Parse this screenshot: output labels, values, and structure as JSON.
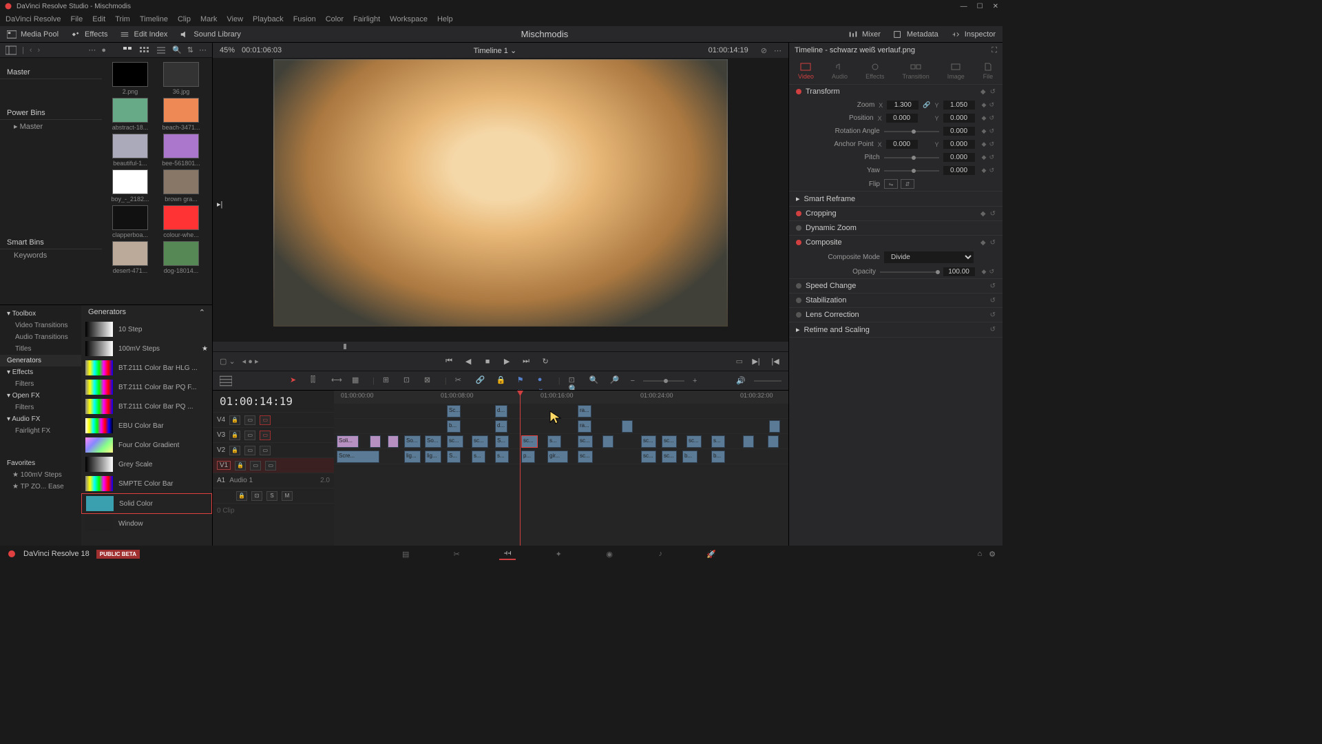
{
  "titlebar": {
    "title": "DaVinci Resolve Studio - Mischmodis"
  },
  "menubar": [
    "DaVinci Resolve",
    "File",
    "Edit",
    "Trim",
    "Timeline",
    "Clip",
    "Mark",
    "View",
    "Playback",
    "Fusion",
    "Color",
    "Fairlight",
    "Workspace",
    "Help"
  ],
  "toolbar": {
    "mediapool": "Media Pool",
    "effects": "Effects",
    "editindex": "Edit Index",
    "soundlib": "Sound Library",
    "mixer": "Mixer",
    "metadata": "Metadata",
    "inspector": "Inspector",
    "project": "Mischmodis"
  },
  "mediapool_bar": {
    "zoom": "45%",
    "tc": "00:01:06:03"
  },
  "bins": {
    "master": "Master",
    "powerbins": "Power Bins",
    "powerbins_master": "Master",
    "smartbins": "Smart Bins",
    "keywords": "Keywords"
  },
  "thumbs": [
    {
      "label": "2.png"
    },
    {
      "label": "36.jpg"
    },
    {
      "label": "abstract-18..."
    },
    {
      "label": "beach-3471..."
    },
    {
      "label": "beautiful-1..."
    },
    {
      "label": "bee-561801..."
    },
    {
      "label": "boy_-_2182..."
    },
    {
      "label": "brown gra..."
    },
    {
      "label": "clapperboa..."
    },
    {
      "label": "colour-whe..."
    },
    {
      "label": "desert-471..."
    },
    {
      "label": "dog-18014..."
    }
  ],
  "fx_tree": [
    {
      "label": "Toolbox",
      "cls": "header"
    },
    {
      "label": "Video Transitions",
      "cls": "child"
    },
    {
      "label": "Audio Transitions",
      "cls": "child"
    },
    {
      "label": "Titles",
      "cls": "child"
    },
    {
      "label": "Generators",
      "cls": "active"
    },
    {
      "label": "Effects",
      "cls": "header"
    },
    {
      "label": "Filters",
      "cls": "child"
    },
    {
      "label": "Open FX",
      "cls": "header"
    },
    {
      "label": "Filters",
      "cls": "child"
    },
    {
      "label": "Audio FX",
      "cls": "header"
    },
    {
      "label": "Fairlight FX",
      "cls": "child"
    }
  ],
  "favorites": {
    "header": "Favorites",
    "items": [
      "100mV Steps",
      "TP ZO... Ease"
    ]
  },
  "generators": {
    "header": "Generators",
    "items": [
      {
        "label": "10 Step",
        "color": "linear-gradient(90deg,#000,#fff)"
      },
      {
        "label": "100mV Steps",
        "color": "linear-gradient(90deg,#000,#fff)",
        "star": true
      },
      {
        "label": "BT.2111 Color Bar HLG ...",
        "color": "linear-gradient(90deg,#888,#ff0,#0ff,#0f0,#f0f,#f00,#00f)"
      },
      {
        "label": "BT.2111 Color Bar PQ F...",
        "color": "linear-gradient(90deg,#888,#ff0,#0ff,#0f0,#f0f,#f00,#00f)"
      },
      {
        "label": "BT.2111 Color Bar PQ ...",
        "color": "linear-gradient(90deg,#888,#ff0,#0ff,#0f0,#f0f,#f00,#00f)"
      },
      {
        "label": "EBU Color Bar",
        "color": "linear-gradient(90deg,#fff,#ff0,#0ff,#0f0,#f0f,#f00,#00f,#000)"
      },
      {
        "label": "Four Color Gradient",
        "color": "linear-gradient(135deg,#f8f,#88f,#8f8,#ff8)"
      },
      {
        "label": "Grey Scale",
        "color": "linear-gradient(90deg,#000,#fff)"
      },
      {
        "label": "SMPTE Color Bar",
        "color": "linear-gradient(90deg,#888,#ff0,#0ff,#0f0,#f0f,#f00,#00f)"
      },
      {
        "label": "Solid Color",
        "color": "#3aa0b0",
        "selected": true
      },
      {
        "label": "Window",
        "color": "#222"
      }
    ]
  },
  "viewer": {
    "timeline_name": "Timeline 1",
    "tc_right": "01:00:14:19"
  },
  "timeline": {
    "tc": "01:00:14:19",
    "ruler": [
      "01:00:00:00",
      "01:00:08:00",
      "01:00:16:00",
      "01:00:24:00",
      "01:00:32:00"
    ],
    "tracks": {
      "v4": "V4",
      "v3": "V3",
      "v2": "V2",
      "v1": "V1",
      "a1": "A1",
      "a1name": "Audio 1",
      "a1val": "2.0",
      "clip0": "0 Clip"
    }
  },
  "inspector": {
    "title": "Timeline - schwarz weiß verlauf.png",
    "tabs": [
      "Video",
      "Audio",
      "Effects",
      "Transition",
      "Image",
      "File"
    ],
    "transform": {
      "header": "Transform",
      "zoom": "Zoom",
      "zoom_x": "1.300",
      "zoom_y": "1.050",
      "position": "Position",
      "pos_x": "0.000",
      "pos_y": "0.000",
      "rotation": "Rotation Angle",
      "rot_val": "0.000",
      "anchor": "Anchor Point",
      "anchor_x": "0.000",
      "anchor_y": "0.000",
      "pitch": "Pitch",
      "pitch_val": "0.000",
      "yaw": "Yaw",
      "yaw_val": "0.000",
      "flip": "Flip"
    },
    "smart_reframe": "Smart Reframe",
    "cropping": "Cropping",
    "dynamic_zoom": "Dynamic Zoom",
    "composite": {
      "header": "Composite",
      "mode_label": "Composite Mode",
      "mode": "Divide",
      "opacity_label": "Opacity",
      "opacity": "100.00"
    },
    "speed": "Speed Change",
    "stabilization": "Stabilization",
    "lens": "Lens Correction",
    "retime": "Retime and Scaling"
  },
  "bottom": {
    "app": "DaVinci Resolve 18",
    "badge": "PUBLIC BETA"
  }
}
